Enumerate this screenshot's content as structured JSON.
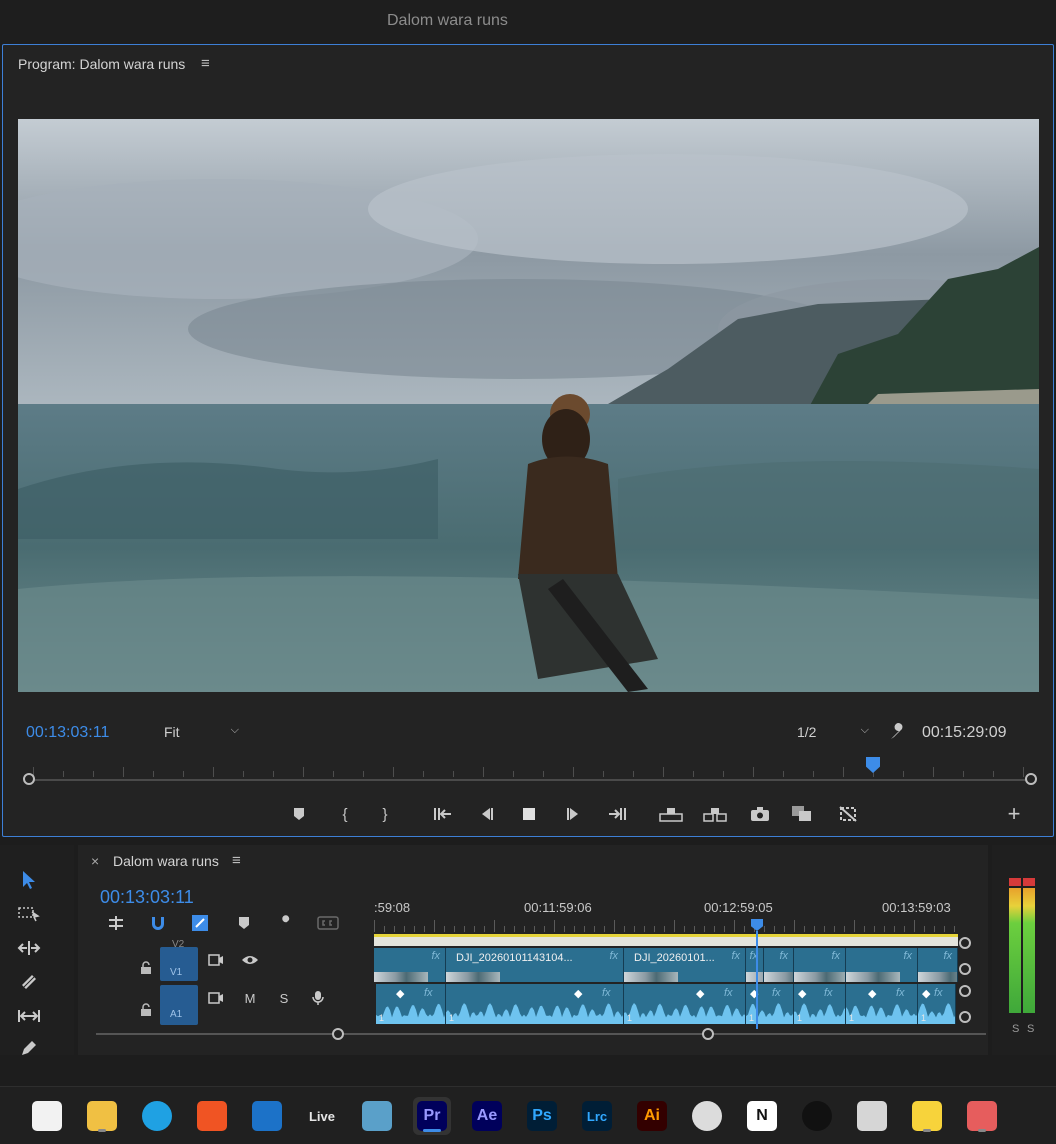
{
  "window": {
    "title": "Dalom wara runs"
  },
  "program_monitor": {
    "panel_title": "Program: Dalom wara runs",
    "menu_icon": "hamburger-menu-icon",
    "current_timecode": "00:13:03:11",
    "zoom_value": "Fit",
    "resolution_value": "1/2",
    "duration_timecode": "00:15:29:09",
    "playhead_fraction": 0.84,
    "transport_icons": [
      "marker-icon",
      "mark-in-icon",
      "mark-out-icon",
      "go-to-in-icon",
      "step-back-icon",
      "stop-icon",
      "step-forward-icon",
      "go-to-out-icon",
      "lift-icon",
      "extract-icon",
      "camera-icon",
      "compare-icon",
      "multicam-icon",
      "add-button-icon"
    ]
  },
  "tools": [
    "selection-icon",
    "track-select-icon",
    "ripple-edit-icon",
    "razor-icon",
    "slip-icon",
    "pen-icon"
  ],
  "timeline": {
    "sequence_name": "Dalom wara runs",
    "timecode": "00:13:03:11",
    "ruler_labels": [
      ":59:08",
      "00:11:59:06",
      "00:12:59:05",
      "00:13:59:03"
    ],
    "tracks": {
      "v2_label": "V2",
      "v1_label": "V1",
      "a1_label": "A1",
      "mute_label": "M",
      "solo_label": "S"
    },
    "video_clips": [
      {
        "name": ""
      },
      {
        "name": "DJI_20260101143104..."
      },
      {
        "name": "DJI_20260101..."
      },
      {
        "name": ""
      },
      {
        "name": ""
      },
      {
        "name": ""
      },
      {
        "name": ""
      },
      {
        "name": ""
      }
    ],
    "fx_label": "fx",
    "audio_channel_label": "1"
  },
  "meters": {
    "left_label": "S",
    "right_label": "S"
  },
  "taskbar": {
    "apps": [
      {
        "name": "microsoft-store",
        "label": "",
        "color": "#f2f2f2"
      },
      {
        "name": "file-explorer",
        "label": "",
        "color": "#f0c043"
      },
      {
        "name": "edge",
        "label": "",
        "color": "#1fa1e3"
      },
      {
        "name": "brave",
        "label": "",
        "color": "#f05423"
      },
      {
        "name": "outlook",
        "label": "",
        "color": "#1c72c8"
      },
      {
        "name": "ableton-live",
        "label": "Live",
        "color": "#e6e6e6"
      },
      {
        "name": "davinci-resolve",
        "label": "",
        "color": "#5aa0c9"
      },
      {
        "name": "premiere-pro",
        "label": "Pr",
        "color": "#9999ff"
      },
      {
        "name": "after-effects",
        "label": "Ae",
        "color": "#9999ff"
      },
      {
        "name": "photoshop",
        "label": "Ps",
        "color": "#31a8ff"
      },
      {
        "name": "lightroom-classic",
        "label": "Lrc",
        "color": "#31a8ff"
      },
      {
        "name": "illustrator",
        "label": "Ai",
        "color": "#ff9a00"
      },
      {
        "name": "obs-studio",
        "label": "",
        "color": "#dcdcdc"
      },
      {
        "name": "notion",
        "label": "N",
        "color": "#111111"
      },
      {
        "name": "capcut",
        "label": "",
        "color": "#111111"
      },
      {
        "name": "calculator",
        "label": "",
        "color": "#d6d6d6"
      },
      {
        "name": "sticky-notes",
        "label": "",
        "color": "#f7d33b"
      },
      {
        "name": "snipping-tool",
        "label": "",
        "color": "#e65d5d"
      }
    ]
  }
}
